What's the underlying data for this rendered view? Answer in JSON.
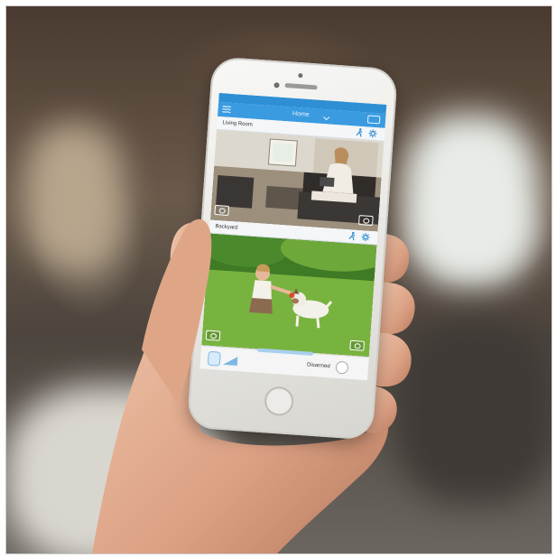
{
  "app": {
    "status_bar": {
      "carrier": "",
      "time": "",
      "battery": ""
    },
    "nav": {
      "title": "Home",
      "menu_icon": "hamburger-menu-icon",
      "devices_icon": "devices-icon"
    },
    "cameras": [
      {
        "name": "Living Room",
        "motion_icon": "motion-person-icon",
        "settings_icon": "settings-gear-icon",
        "clip_icon": "clip-icon",
        "snapshot_icon": "snapshot-camera-icon"
      },
      {
        "name": "Backyard",
        "motion_icon": "motion-person-icon",
        "settings_icon": "settings-gear-icon",
        "clip_icon": "clip-icon",
        "snapshot_icon": "snapshot-camera-icon"
      }
    ],
    "footer": {
      "mode_label": "Disarmed",
      "base_icon": "base-station-icon",
      "signal_icon": "signal-strength-icon"
    },
    "accent_color": "#3a9be0"
  }
}
